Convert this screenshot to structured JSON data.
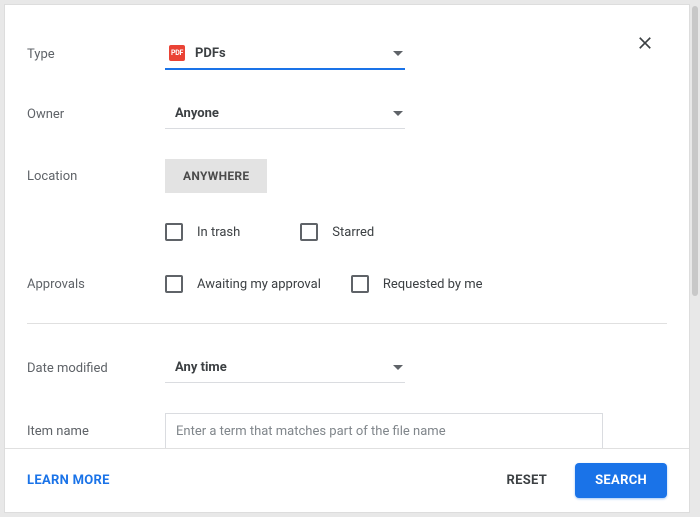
{
  "labels": {
    "type": "Type",
    "owner": "Owner",
    "location": "Location",
    "approvals": "Approvals",
    "date_modified": "Date modified",
    "item_name": "Item name"
  },
  "type": {
    "value": "PDFs",
    "icon_text": "PDF"
  },
  "owner": {
    "value": "Anyone"
  },
  "location": {
    "chip": "ANYWHERE"
  },
  "checks": {
    "in_trash": "In trash",
    "starred": "Starred",
    "awaiting": "Awaiting my approval",
    "requested": "Requested by me"
  },
  "date_modified": {
    "value": "Any time"
  },
  "item_name": {
    "placeholder": "Enter a term that matches part of the file name"
  },
  "footer": {
    "learn_more": "LEARN MORE",
    "reset": "RESET",
    "search": "SEARCH"
  }
}
